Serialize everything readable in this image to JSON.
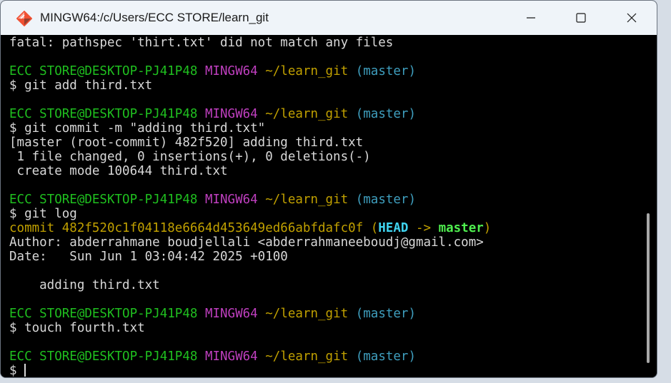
{
  "window": {
    "title": "MINGW64:/c/Users/ECC STORE/learn_git",
    "app_icon": "git-bash-icon",
    "controls": {
      "minimize_icon": "minimize-icon",
      "maximize_icon": "maximize-icon",
      "close_icon": "close-icon"
    }
  },
  "colors": {
    "prompt_user": "#1fbf1f",
    "prompt_env": "#bf3fbf",
    "prompt_path": "#c0a000",
    "prompt_branch": "#3f9fbf",
    "head_ref": "#3fd3ef",
    "master_ref": "#4fef4f",
    "text": "#d8d8d8",
    "background": "#000000"
  },
  "terminal": {
    "fatal_line": "fatal: pathspec 'thirt.txt' did not match any files",
    "prompt": {
      "user_host": "ECC STORE@DESKTOP-PJ41P48",
      "env": "MINGW64",
      "path": "~/learn_git",
      "branch": "(master)"
    },
    "cmd1": "$ git add third.txt",
    "cmd2": "$ git commit -m \"adding third.txt\"",
    "commit_out1": "[master (root-commit) 482f520] adding third.txt",
    "commit_out2": " 1 file changed, 0 insertions(+), 0 deletions(-)",
    "commit_out3": " create mode 100644 third.txt",
    "cmd3": "$ git log",
    "log_commit_prefix": "commit 482f520c1f04118e6664d453649ed66abfdafc0f (",
    "log_head": "HEAD",
    "log_arrow": " -> ",
    "log_master": "master",
    "log_close": ")",
    "log_author": "Author: abderrahmane boudjellali <abderrahmaneeboudj@gmail.com>",
    "log_date": "Date:   Sun Jun 1 03:04:42 2025 +0100",
    "log_message": "    adding third.txt",
    "cmd4": "$ touch fourth.txt",
    "final_prompt": "$ "
  }
}
